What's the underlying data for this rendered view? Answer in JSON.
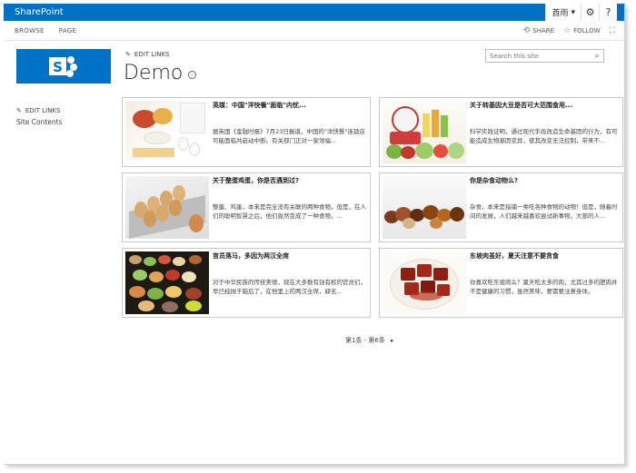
{
  "suite": {
    "brand": "SharePoint",
    "user": "酋雨",
    "settings_icon": "gear-icon",
    "help_icon": "help-icon",
    "help_glyph": "?"
  },
  "ribbon": {
    "tabs": [
      "BROWSE",
      "PAGE"
    ],
    "share_label": "SHARE",
    "follow_label": "FOLLOW",
    "focus_icon": "focus-icon"
  },
  "header": {
    "edit_links": "EDIT LINKS",
    "title": "Demo",
    "search_placeholder": "Search this site"
  },
  "leftnav": {
    "edit_links": "EDIT LINKS",
    "items": [
      "Site Contents"
    ]
  },
  "cards": [
    {
      "title": "英媒：中国\"洋快餐\"面临\"内忧...",
      "description": "据英国《金融时报》7月23日报道，中国的\"洋快餐\"连锁店可能面临共启动中断。有关部门正对一家领福...",
      "image": "eggs-breakfast-photo"
    },
    {
      "title": "关于转基因大豆是否可大范围食用...",
      "description": "科学实践证明，通过现代手段改造生命基因的行为，有可能造成生物基因变异，使其改变无法控制，带来不...",
      "image": "fruit-vegetables-scale-photo"
    },
    {
      "title": "关于整蛋鸡蛋，你是否遇到过?",
      "description": "整蛋、鸡蛋，本来是完全没有关联的两种食物，但是，在人们的聪明智慧之后，他们竟然变成了一种食物，...",
      "image": "egg-carton-photo"
    },
    {
      "title": "你是杂食动物么?",
      "description": "杂食，本来是指捕一类吃各种食物的动物！但是，随着时间的发展，人们越来越喜欢尝试新事物，大部的人...",
      "image": "mixed-food-photo"
    },
    {
      "title": "官员落马，多因为两汉全席",
      "description": "对于中华民族的传统美德，现在大多数有钱有权的官员们，早已经抛于脑后了，在他里上的两汉全席，肆无...",
      "image": "banquet-dishes-photo"
    },
    {
      "title": "东坡肉虽好，夏天注意不要贪食",
      "description": "你喜欢吃东坡肉么？夏天吃太多的肉，尤其过多的肥肉并不是健康的习惯，虽然美味，要需要注意身体。",
      "image": "braised-pork-photo"
    }
  ],
  "pager": {
    "label": "第1条 - 第6条",
    "next_glyph": "▸"
  },
  "colors": {
    "suite_bar": "#0072c6",
    "logo_bg": "#0072c6"
  }
}
